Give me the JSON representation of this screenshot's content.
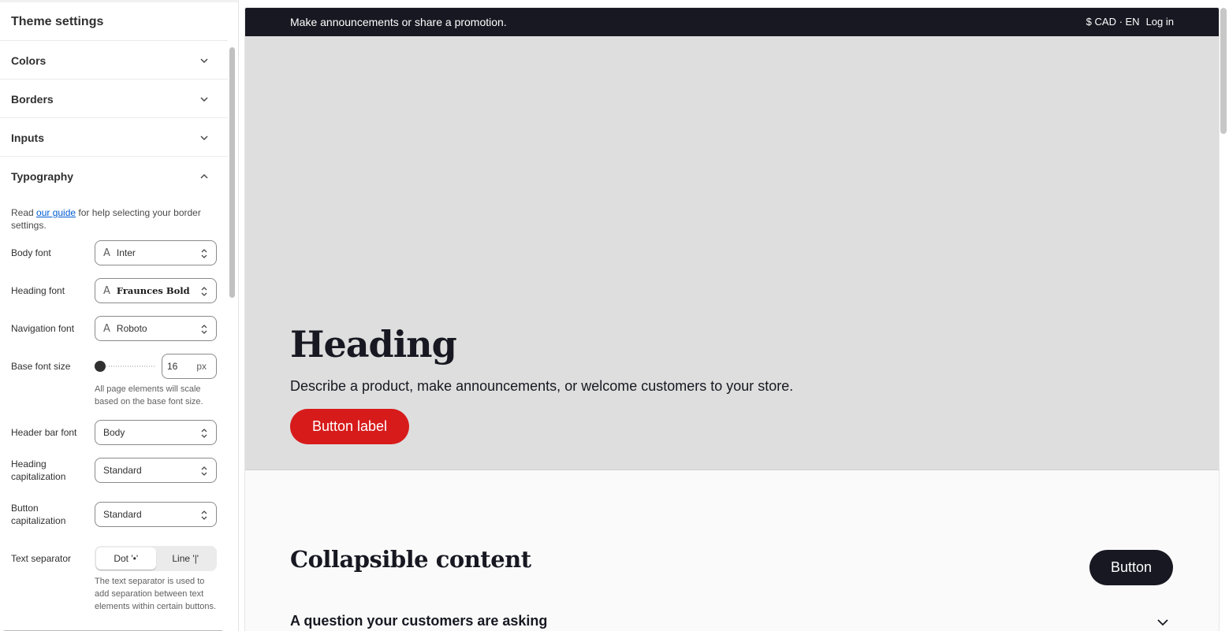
{
  "sidebar": {
    "title": "Theme settings",
    "sections": [
      {
        "label": "Colors",
        "icon": "chevron-down-icon"
      },
      {
        "label": "Borders",
        "icon": "chevron-down-icon"
      },
      {
        "label": "Inputs",
        "icon": "chevron-down-icon"
      },
      {
        "label": "Typography",
        "icon": "chevron-up-icon"
      }
    ],
    "typography": {
      "help_prefix": "Read ",
      "help_link": "our guide",
      "help_suffix": " for help selecting your border settings.",
      "body_font": {
        "label": "Body font",
        "value": "Inter"
      },
      "heading_font": {
        "label": "Heading font",
        "value": "Fraunces Bold"
      },
      "navigation_font": {
        "label": "Navigation font",
        "value": "Roboto"
      },
      "base_font_size": {
        "label": "Base font size",
        "value": "16",
        "unit": "px",
        "hint": "All page elements will scale based on the base font size."
      },
      "header_bar_font": {
        "label": "Header bar font",
        "value": "Body"
      },
      "heading_capitalization": {
        "label": "Heading capitalization",
        "value": "Standard"
      },
      "button_capitalization": {
        "label": "Button capitalization",
        "value": "Standard"
      },
      "text_separator": {
        "label": "Text separator",
        "options": [
          "Dot '•'",
          "Line '|'"
        ],
        "selected": "Dot '•'",
        "hint": "The text separator is used to add separation between text elements within certain buttons."
      }
    }
  },
  "preview": {
    "announcement": "Make announcements or share a promotion.",
    "currency_locale": "$ CAD · EN",
    "login": "Log in",
    "hero": {
      "heading": "Heading",
      "text": "Describe a product, make announcements, or welcome customers to your store.",
      "button": "Button label"
    },
    "collapsible": {
      "title": "Collapsible content",
      "button": "Button",
      "question": "A question your customers are asking"
    }
  },
  "colors": {
    "announcement_bg": "#171821",
    "hero_bg": "#dedede",
    "primary_button": "#d71b1b",
    "dark_button": "#171821",
    "link": "#005bd3"
  }
}
